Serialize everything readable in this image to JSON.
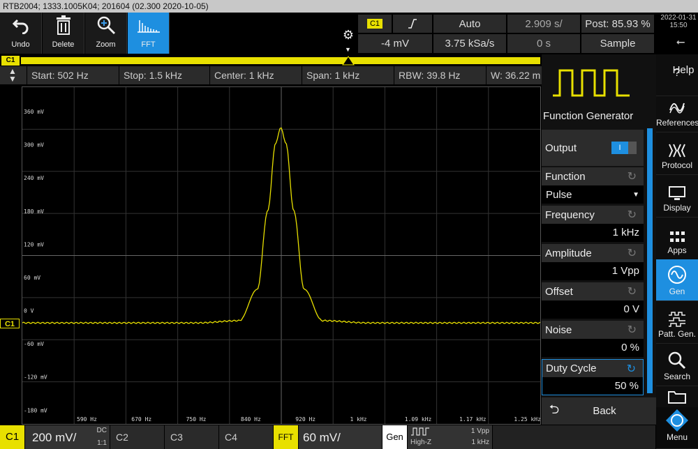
{
  "window": {
    "title": "RTB2004; 1333.1005K04; 201604 (02.300 2020-10-05)"
  },
  "toolbar": {
    "undo": "Undo",
    "delete": "Delete",
    "zoom": "Zoom",
    "fft": "FFT"
  },
  "trigger": {
    "source": "C1",
    "mode": "Auto",
    "level": "-4 mV",
    "sample_rate": "3.75 kSa/s",
    "time_scale": "2.909 s/",
    "position": "0 s",
    "post": "Post: 85.93 %",
    "acq_mode": "Sample"
  },
  "clock": {
    "date": "2022-01-31",
    "time": "15:50"
  },
  "channel_tag": "C1",
  "fft_info": {
    "start": "Start: 502 Hz",
    "stop": "Stop: 1.5 kHz",
    "center": "Center: 1 kHz",
    "span": "Span: 1 kHz",
    "rbw": "RBW: 39.8 Hz",
    "window": "W: 36.22 m"
  },
  "chart_data": {
    "type": "line",
    "y_tick_labels": [
      "360 mV",
      "300 mV",
      "240 mV",
      "180 mV",
      "120 mV",
      "60 mV",
      "0 V",
      "-60 mV",
      "-120 mV",
      "-180 mV"
    ],
    "x_tick_labels": [
      "590 Hz",
      "670 Hz",
      "750 Hz",
      "840 Hz",
      "920 Hz",
      "1 kHz",
      "1.09 kHz",
      "1.17 kHz",
      "1.25 kHz"
    ],
    "ylim": [
      -180,
      420
    ],
    "xlim": [
      502,
      1500
    ],
    "grid": true,
    "series": [
      {
        "color": "#e8e000",
        "x": [
          502,
          840,
          920,
          955,
          975,
          990,
          1000,
          1010,
          1025,
          1045,
          1080,
          1170,
          1500
        ],
        "y": [
          0,
          0,
          4,
          60,
          200,
          320,
          348,
          320,
          200,
          60,
          4,
          0,
          0
        ]
      }
    ]
  },
  "function_generator": {
    "title": "Function Generator",
    "output_label": "Output",
    "output_state": "I",
    "fields": [
      {
        "label": "Function",
        "value": "Pulse"
      },
      {
        "label": "Frequency",
        "value": "1 kHz"
      },
      {
        "label": "Amplitude",
        "value": "1 Vpp"
      },
      {
        "label": "Offset",
        "value": "0 V"
      },
      {
        "label": "Noise",
        "value": "0 %"
      },
      {
        "label": "Duty Cycle",
        "value": "50 %"
      }
    ],
    "back": "Back"
  },
  "side_nav": [
    {
      "label": "Help",
      "icon": "help-icon"
    },
    {
      "label": "References",
      "icon": "reference-icon"
    },
    {
      "label": "Protocol",
      "icon": "protocol-icon"
    },
    {
      "label": "Display",
      "icon": "display-icon"
    },
    {
      "label": "Apps",
      "icon": "apps-icon"
    },
    {
      "label": "Gen",
      "icon": "sine-wave-icon"
    },
    {
      "label": "Patt. Gen.",
      "icon": "pattern-generator-icon"
    },
    {
      "label": "Search",
      "icon": "search-icon"
    },
    {
      "label": "Menu",
      "icon": "menu-icon"
    }
  ],
  "bottom": {
    "c1_label": "C1",
    "c1_scale": "200 mV/",
    "c1_coupling": "DC",
    "c1_probe": "1:1",
    "c2": "C2",
    "c3": "C3",
    "c4": "C4",
    "fft_label": "FFT",
    "fft_scale": "60 mV/",
    "gen_label": "Gen",
    "gen_load": "High-Z",
    "gen_amp": "1 Vpp",
    "gen_freq": "1 kHz"
  }
}
